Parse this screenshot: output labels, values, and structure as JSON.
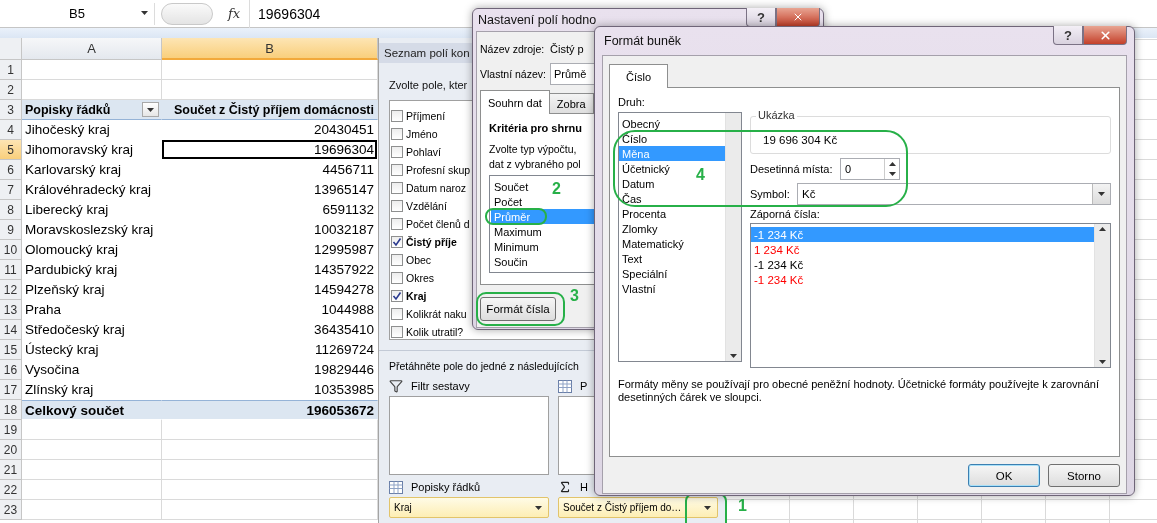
{
  "sheet": {
    "name_box": "B5",
    "fx_label": "fx",
    "formula": "19696304",
    "columns": [
      {
        "label": "A",
        "selected": false
      },
      {
        "label": "B",
        "selected": true
      }
    ],
    "rows": [
      {
        "number": "1",
        "kind": "blank",
        "selected": false
      },
      {
        "number": "2",
        "kind": "blank",
        "selected": false
      },
      {
        "number": "3",
        "kind": "header",
        "label": "Popisky řádků",
        "value": "Součet z Čistý příjem domácnosti",
        "selected": false
      },
      {
        "number": "4",
        "kind": "data",
        "label": "Jihočeský kraj",
        "value": "20430451",
        "selected": false
      },
      {
        "number": "5",
        "kind": "data",
        "label": "Jihomoravský kraj",
        "value": "19696304",
        "selected": true
      },
      {
        "number": "6",
        "kind": "data",
        "label": "Karlovarský kraj",
        "value": "4456711",
        "selected": false
      },
      {
        "number": "7",
        "kind": "data",
        "label": "Královéhradecký kraj",
        "value": "13965147",
        "selected": false
      },
      {
        "number": "8",
        "kind": "data",
        "label": "Liberecký kraj",
        "value": "6591132",
        "selected": false
      },
      {
        "number": "9",
        "kind": "data",
        "label": "Moravskoslezský kraj",
        "value": "10032187",
        "selected": false
      },
      {
        "number": "10",
        "kind": "data",
        "label": "Olomoucký kraj",
        "value": "12995987",
        "selected": false
      },
      {
        "number": "11",
        "kind": "data",
        "label": "Pardubický kraj",
        "value": "14357922",
        "selected": false
      },
      {
        "number": "12",
        "kind": "data",
        "label": "Plzeňský kraj",
        "value": "14594278",
        "selected": false
      },
      {
        "number": "13",
        "kind": "data",
        "label": "Praha",
        "value": "1044988",
        "selected": false
      },
      {
        "number": "14",
        "kind": "data",
        "label": "Středočeský kraj",
        "value": "36435410",
        "selected": false
      },
      {
        "number": "15",
        "kind": "data",
        "label": "Ústecký kraj",
        "value": "11269724",
        "selected": false
      },
      {
        "number": "16",
        "kind": "data",
        "label": "Vysočina",
        "value": "19829446",
        "selected": false
      },
      {
        "number": "17",
        "kind": "data",
        "label": "Zlínský kraj",
        "value": "10353985",
        "selected": false
      },
      {
        "number": "18",
        "kind": "total",
        "label": "Celkový součet",
        "value": "196053672",
        "selected": false
      },
      {
        "number": "19",
        "kind": "blank",
        "selected": false
      },
      {
        "number": "20",
        "kind": "blank",
        "selected": false
      },
      {
        "number": "21",
        "kind": "blank",
        "selected": false
      },
      {
        "number": "22",
        "kind": "blank",
        "selected": false
      },
      {
        "number": "23",
        "kind": "blank",
        "selected": false
      }
    ]
  },
  "field_list": {
    "title": "Seznam polí kon",
    "prompt": "Zvolte pole, kter",
    "fields": [
      {
        "label": "Příjmení",
        "checked": false
      },
      {
        "label": "Jméno",
        "checked": false
      },
      {
        "label": "Pohlaví",
        "checked": false
      },
      {
        "label": "Profesní skup",
        "checked": false
      },
      {
        "label": "Datum naroz",
        "checked": false
      },
      {
        "label": "Vzdělání",
        "checked": false
      },
      {
        "label": "Počet členů d",
        "checked": false
      },
      {
        "label": "Čistý příje",
        "checked": true
      },
      {
        "label": "Obec",
        "checked": false
      },
      {
        "label": "Okres",
        "checked": false
      },
      {
        "label": "Kraj",
        "checked": true
      },
      {
        "label": "Kolikrát naku",
        "checked": false
      },
      {
        "label": "Kolik utratil?",
        "checked": false
      }
    ],
    "drag_hint": "Přetáhněte pole do jedné z následujících",
    "areas": [
      {
        "kind": "filter",
        "label": "Filtr sestavy"
      },
      {
        "kind": "columns",
        "label": "P"
      },
      {
        "kind": "rows",
        "label": "Popisky řádků",
        "field": "Kraj"
      },
      {
        "kind": "values",
        "label": "H",
        "field": "Součet z Čistý příjem do…"
      }
    ]
  },
  "value_settings": {
    "title": "Nastavení polí hodno",
    "help": "?",
    "source_label": "Název zdroje:",
    "source_value": "Čistý p",
    "custom_label": "Vlastní název:",
    "custom_value": "Průmě",
    "tabs": [
      {
        "label": "Souhrn dat",
        "selected": true
      },
      {
        "label": "Zobra",
        "selected": false
      }
    ],
    "section_title": "Kritéria pro shrnu",
    "instructions": [
      "Zvolte typ výpočtu,",
      "dat z vybraného pol"
    ],
    "functions": [
      {
        "label": "Součet",
        "selected": false
      },
      {
        "label": "Počet",
        "selected": false
      },
      {
        "label": "Průměr",
        "selected": true
      },
      {
        "label": "Maximum",
        "selected": false
      },
      {
        "label": "Minimum",
        "selected": false
      },
      {
        "label": "Součin",
        "selected": false
      }
    ],
    "number_format_button": "Formát čísla"
  },
  "format_cells": {
    "title": "Formát buněk",
    "help": "?",
    "tabs": [
      {
        "label": "Číslo",
        "selected": true
      }
    ],
    "category_label": "Druh:",
    "categories": [
      {
        "label": "Obecný",
        "selected": false
      },
      {
        "label": "Číslo",
        "selected": false
      },
      {
        "label": "Měna",
        "selected": true
      },
      {
        "label": "Účetnický",
        "selected": false
      },
      {
        "label": "Datum",
        "selected": false
      },
      {
        "label": "Čas",
        "selected": false
      },
      {
        "label": "Procenta",
        "selected": false
      },
      {
        "label": "Zlomky",
        "selected": false
      },
      {
        "label": "Matematický",
        "selected": false
      },
      {
        "label": "Text",
        "selected": false
      },
      {
        "label": "Speciální",
        "selected": false
      },
      {
        "label": "Vlastní",
        "selected": false
      }
    ],
    "sample_label": "Ukázka",
    "sample_value": "19 696 304 Kč",
    "decimals_label": "Desetinná místa:",
    "decimals_value": "0",
    "symbol_label": "Symbol:",
    "symbol_value": "Kč",
    "negative_label": "Záporná čísla:",
    "negative_formats": [
      {
        "label": "-1 234 Kč",
        "selected": true
      },
      {
        "label": "1 234 Kč",
        "color": "#ff0000",
        "selected": false
      },
      {
        "label": "-1 234 Kč",
        "color": "#000000",
        "selected": false
      },
      {
        "label": "-1 234 Kč",
        "color": "#ff0000",
        "selected": false
      }
    ],
    "description": "Formáty měny se používají pro obecné peněžní hodnoty. Účetnické formáty používejte k zarovnání desetinných čárek ve sloupci.",
    "buttons": [
      "OK",
      "Storno"
    ]
  },
  "annotations": [
    {
      "label": "1"
    },
    {
      "label": "2"
    },
    {
      "label": "3"
    },
    {
      "label": "4"
    }
  ]
}
